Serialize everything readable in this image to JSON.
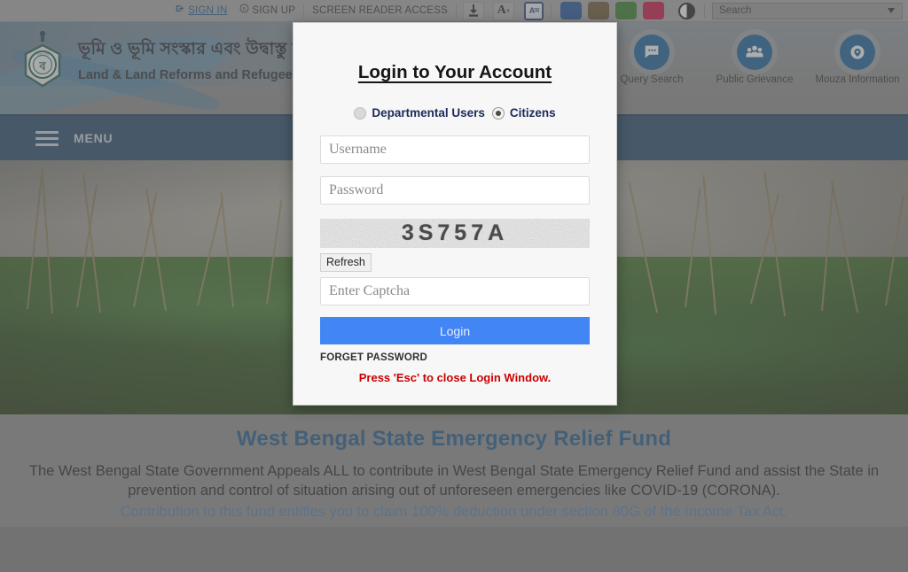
{
  "topbar": {
    "sign_in": "SIGN IN",
    "sign_up": "SIGN UP",
    "screen_reader": "SCREEN READER ACCESS",
    "download_icon": "download-icon",
    "font_size_icon": "font-size-icon",
    "language_icon": "language-toggle-icon",
    "contrast_icon": "contrast-toggle-icon",
    "search_placeholder": "Search",
    "search_value": "",
    "swatches": [
      {
        "name": "theme-blue",
        "color": "#1b4fa0"
      },
      {
        "name": "theme-brown",
        "color": "#6b5230"
      },
      {
        "name": "theme-green",
        "color": "#2f7a22"
      },
      {
        "name": "theme-crimson",
        "color": "#c9093f"
      }
    ]
  },
  "masthead": {
    "title_bn": "ভূমি ও ভূমি সংস্কার এবং উদ্বাস্তু ত্রাণ ও পু",
    "title_en": "Land & Land Reforms and Refugee Relief and Rehabili",
    "emblem_icon": "government-emblem-icon",
    "quick_links": [
      {
        "label": "Query Search",
        "icon": "chat-query-icon"
      },
      {
        "label": "Public Grievance",
        "icon": "people-group-icon"
      },
      {
        "label": "Mouza Information",
        "icon": "map-pin-icon"
      }
    ]
  },
  "menubar": {
    "label": "MENU",
    "icon": "hamburger-menu-icon"
  },
  "relief": {
    "title": "West Bengal State Emergency Relief Fund",
    "body": "The West Bengal State Government Appeals ALL to contribute in West Bengal State Emergency Relief Fund and assist the State in prevention and control of situation arising out of unforeseen emergencies like COVID-19 (CORONA).",
    "link": "Contribution to this fund entitles you to claim 100% deduction under section 80G of the Income Tax Act."
  },
  "modal": {
    "title": "Login to Your Account",
    "radio_departmental": "Departmental Users",
    "radio_citizens": "Citizens",
    "selected_role": "Citizens",
    "username_placeholder": "Username",
    "username_value": "",
    "password_placeholder": "Password",
    "password_value": "",
    "captcha_text": "3S757A",
    "refresh_label": "Refresh",
    "captcha_placeholder": "Enter Captcha",
    "captcha_value": "",
    "login_label": "Login",
    "forget_password": "FORGET PASSWORD",
    "esc_note": "Press 'Esc' to close Login Window.",
    "accent_color": "#4285f4",
    "warning_color": "#cc0000"
  }
}
